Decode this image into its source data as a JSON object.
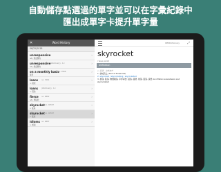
{
  "headline": {
    "line1": "自動儲存點選過的單字並可以在字彙紀錄中",
    "line2": "匯出成單字卡提升單字量"
  },
  "sidebar": {
    "title": "Word History",
    "close_icon": "close-icon",
    "date": "06/25/2018",
    "rows": [
      {
        "word": "unresponsive",
        "rank": "",
        "def": "adj. 無反應的"
      },
      {
        "word": "unresponsive",
        "rank": "(#Actively) · 1×",
        "def": "adj. 無反應的"
      },
      {
        "word": "on a monthly basis",
        "rank": "no. 4566",
        "def": "按月"
      },
      {
        "word": "loans",
        "rank": "no. 3261",
        "def": "n. 貸款"
      },
      {
        "word": "loans",
        "rank": "(#Actively) · 1×",
        "def": "n. 貸款"
      },
      {
        "word": "fierce",
        "rank": "no. 6882",
        "def": "adj. 兇猛的"
      },
      {
        "word": "skyrocket",
        "rank": "no. 46597",
        "def": "v. 猛漲"
      },
      {
        "word": "skyrocket",
        "rank": "no. 46597",
        "def": "v. 猛漲"
      },
      {
        "word": "idioms",
        "rank": "no. 6887",
        "def": "n. 成語"
      }
    ],
    "selected_index": 7
  },
  "detail": {
    "dictionary": "IDMDictionary",
    "word": "skyrocket",
    "pronunciation": "/ˈskaɪˌrɒkɪt/",
    "section_title": "Definition",
    "body_line1": "v. 猛漲；突然高升",
    "body_line2": "1. 扶搖直上 (Sort of Fireworks)",
    "body_line3": "2. skyrocket / skyrocketing / skyrocketed",
    "body_line4": "3. 暴漲, 猛漲, 物價飛漲, 平步青雲, 猛漲, 猛增, 暴漲, 猛漲, 突然 As inflation soaredwere and skyrocketed"
  },
  "colors": {
    "background": "#3a7f76",
    "section": "#8e9aa2",
    "selected_row": "#d8d8d8"
  }
}
